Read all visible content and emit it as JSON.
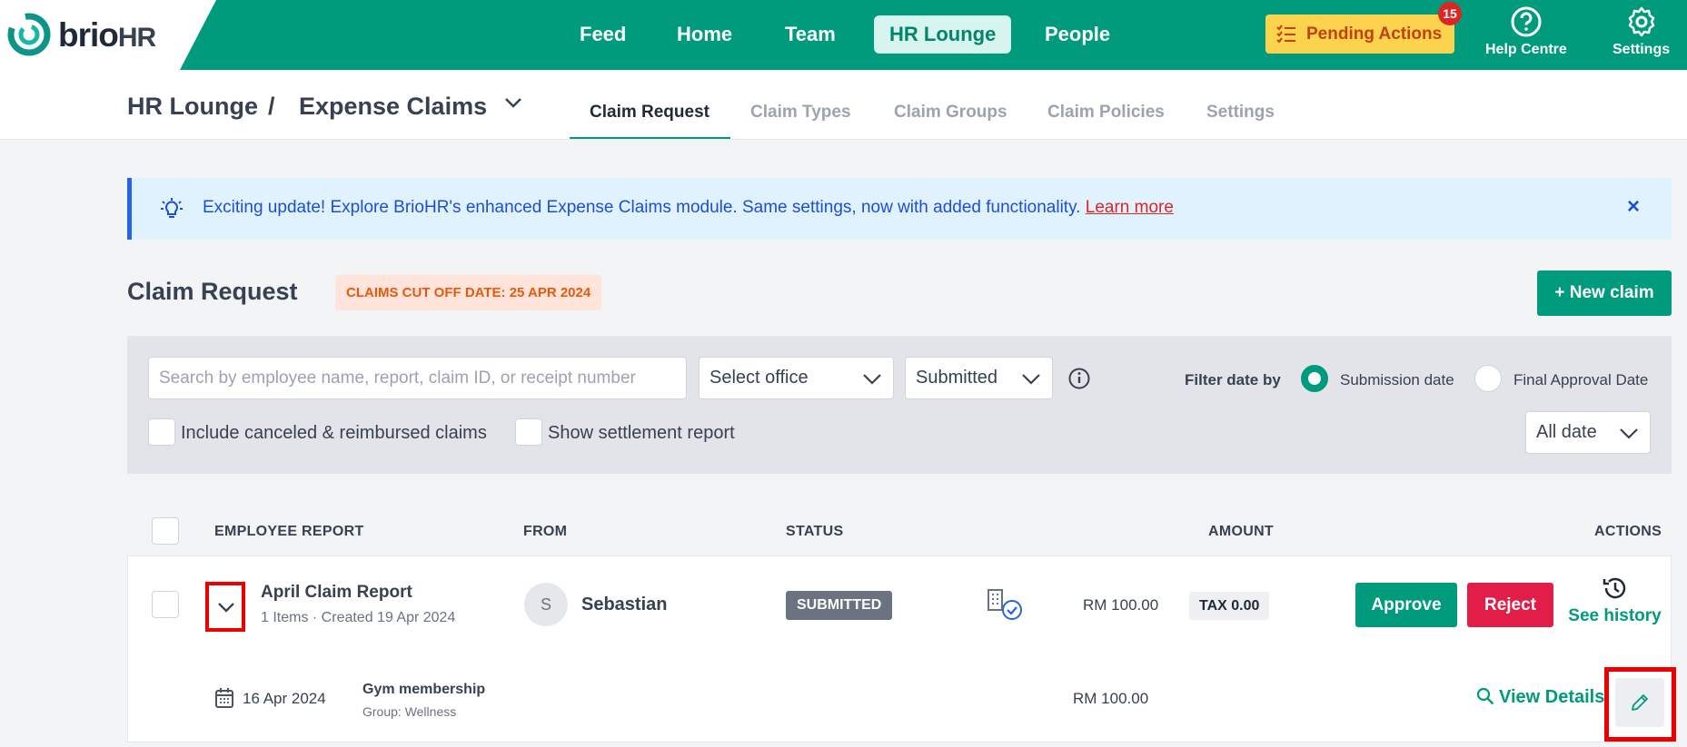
{
  "app": {
    "logo_text": "brio",
    "logo_suffix": "HR",
    "nav": [
      {
        "label": "Feed"
      },
      {
        "label": "Home"
      },
      {
        "label": "Team"
      },
      {
        "label": "HR Lounge",
        "active": true
      },
      {
        "label": "People"
      }
    ],
    "pending_actions": {
      "label": "Pending Actions",
      "count": "15"
    },
    "help_label": "Help Centre",
    "settings_label": "Settings",
    "accent_color": "#009a7c"
  },
  "breadcrumb": {
    "section": "HR Lounge",
    "separator": "/",
    "page": "Expense Claims"
  },
  "tabs": [
    {
      "label": "Claim Request",
      "active": true
    },
    {
      "label": "Claim Types"
    },
    {
      "label": "Claim Groups"
    },
    {
      "label": "Claim Policies"
    },
    {
      "label": "Settings"
    }
  ],
  "banner": {
    "icon": "lightbulb-icon",
    "text": "Exciting update! Explore BrioHR's enhanced Expense Claims module. Same settings, now with added functionality.",
    "link_label": "Learn more",
    "close_glyph": "×"
  },
  "claim_request": {
    "title": "Claim Request",
    "cutoff_label": "CLAIMS CUT OFF DATE: 25 APR 2024",
    "new_claim_label": "+ New claim"
  },
  "filters": {
    "search_placeholder": "Search by employee name, report, claim ID, or receipt number",
    "office_value": "Select office",
    "status_value": "Submitted",
    "filter_date_label": "Filter date by",
    "radio_submission": "Submission date",
    "radio_final": "Final Approval Date",
    "include_canceled": "Include canceled & reimbursed claims",
    "show_settlement": "Show settlement report",
    "date_range_value": "All date"
  },
  "table": {
    "headers": {
      "employee_report": "EMPLOYEE REPORT",
      "from": "FROM",
      "status": "STATUS",
      "amount": "AMOUNT",
      "actions": "ACTIONS"
    },
    "rows": [
      {
        "report_name": "April Claim Report",
        "meta": "1 Items · Created 19 Apr 2024",
        "avatar_initial": "S",
        "from": "Sebastian",
        "status": "SUBMITTED",
        "amount": "RM 100.00",
        "tax": "TAX 0.00",
        "approve_label": "Approve",
        "reject_label": "Reject",
        "history_label": "See history",
        "items": [
          {
            "date": "16 Apr 2024",
            "name": "Gym membership",
            "group": "Group: Wellness",
            "amount": "RM 100.00",
            "view_label": "View Details"
          }
        ]
      }
    ]
  }
}
